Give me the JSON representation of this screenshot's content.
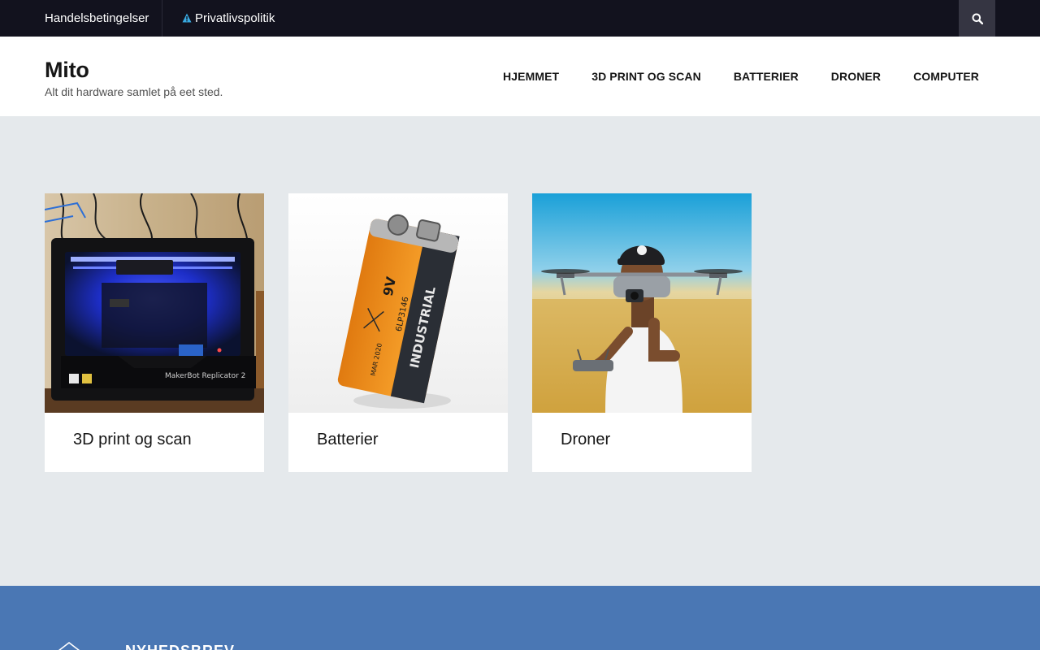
{
  "topbar": {
    "links": [
      {
        "label": "Handelsbetingelser"
      },
      {
        "label": "Privatlivspolitik"
      }
    ]
  },
  "header": {
    "site_title": "Mito",
    "tagline": "Alt dit hardware samlet på eet sted.",
    "nav": [
      {
        "label": "HJEMMET"
      },
      {
        "label": "3D PRINT OG SCAN"
      },
      {
        "label": "BATTERIER"
      },
      {
        "label": "DRONER"
      },
      {
        "label": "COMPUTER"
      }
    ]
  },
  "cards": [
    {
      "title": "3D print og scan"
    },
    {
      "title": "Batterier"
    },
    {
      "title": "Droner"
    }
  ],
  "footer": {
    "newsletter_title": "NYHEDSBREV"
  },
  "colors": {
    "topbar_bg": "#12121e",
    "page_bg": "#e5e9ec",
    "footer_bg": "#4a77b4",
    "search_bg": "#353542"
  }
}
